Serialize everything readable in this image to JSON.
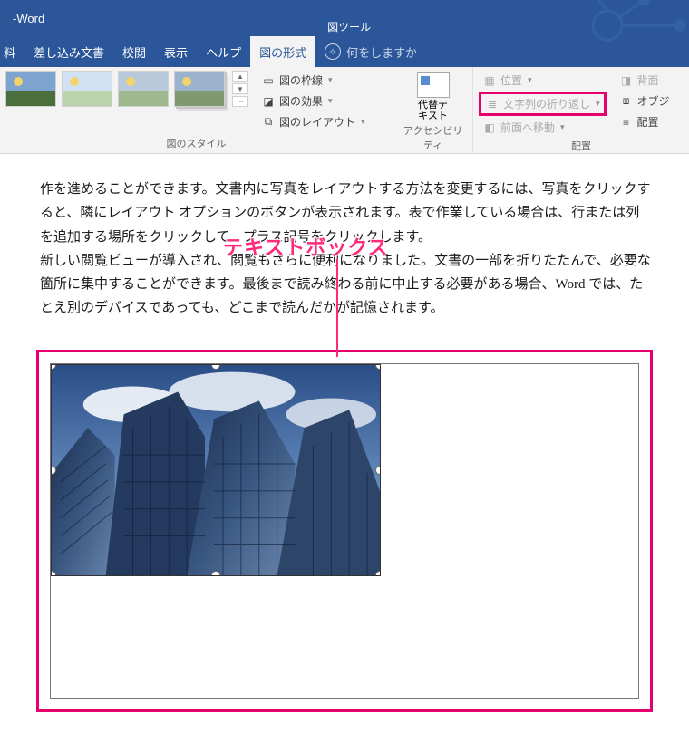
{
  "title": {
    "app": "Word",
    "dash": " - "
  },
  "contextual_tab": "図ツール",
  "menus": {
    "sashikomi": "差し込み文書",
    "kouetsu": "校閲",
    "hyouji": "表示",
    "help": "ヘルプ",
    "format": "図の形式"
  },
  "tellme": {
    "placeholder": "何をしますか"
  },
  "ribbon": {
    "styles_label": "図のスタイル",
    "accessibility_label": "アクセシビリティ",
    "arrange_label": "配置",
    "border": "図の枠線",
    "effects": "図の効果",
    "layout": "図のレイアウト",
    "alt": {
      "l1": "代替テ",
      "l2": "キスト"
    },
    "pos": "位置",
    "wrap": "文字列の折り返し",
    "front": "前面へ移動",
    "back": "背面",
    "obj": "オブジ",
    "align": "配置"
  },
  "doc": {
    "p1": "作を進めることができます。文書内に写真をレイアウトする方法を変更するには、写真をクリックすると、隣にレイアウト オプションのボタンが表示されます。表で作業している場合は、行または列を追加する場所をクリックして、プラス記号をクリックします。",
    "p2": "新しい閲覧ビューが導入され、閲覧もさらに便利になりました。文書の一部を折りたたんで、必要な箇所に集中することができます。最後まで読み終わる前に中止する必要がある場合、Word では、たとえ別のデバイスであっても、どこまで読んだかが記憶されます。"
  },
  "annotation": "テキストボックス"
}
